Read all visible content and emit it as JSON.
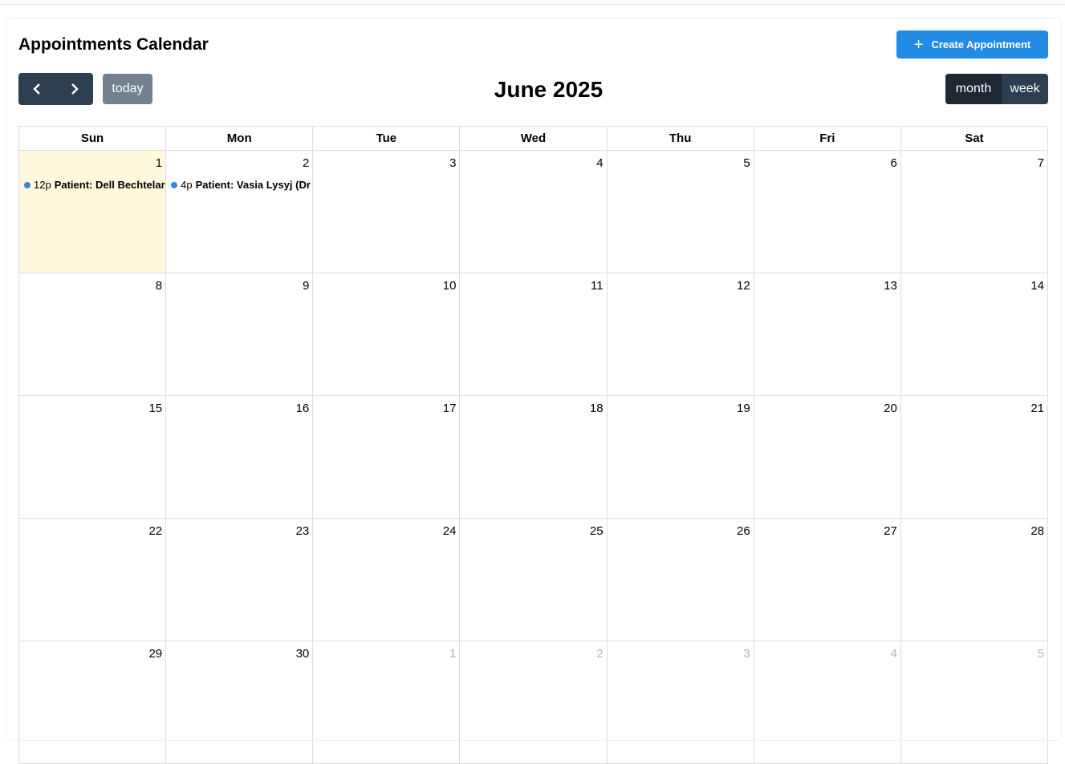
{
  "header": {
    "title": "Appointments Calendar",
    "create_label": "Create Appointment",
    "create_icon": "plus-icon"
  },
  "toolbar": {
    "prev_icon": "chevron-left-icon",
    "next_icon": "chevron-right-icon",
    "today_label": "today",
    "title": "June 2025",
    "views": [
      "month",
      "week"
    ],
    "active_view": "month"
  },
  "calendar": {
    "weekdays": [
      "Sun",
      "Mon",
      "Tue",
      "Wed",
      "Thu",
      "Fri",
      "Sat"
    ],
    "weeks": [
      [
        {
          "d": "1",
          "today": true
        },
        {
          "d": "2"
        },
        {
          "d": "3"
        },
        {
          "d": "4"
        },
        {
          "d": "5"
        },
        {
          "d": "6"
        },
        {
          "d": "7"
        }
      ],
      [
        {
          "d": "8"
        },
        {
          "d": "9"
        },
        {
          "d": "10"
        },
        {
          "d": "11"
        },
        {
          "d": "12"
        },
        {
          "d": "13"
        },
        {
          "d": "14"
        }
      ],
      [
        {
          "d": "15"
        },
        {
          "d": "16"
        },
        {
          "d": "17"
        },
        {
          "d": "18"
        },
        {
          "d": "19"
        },
        {
          "d": "20"
        },
        {
          "d": "21"
        }
      ],
      [
        {
          "d": "22"
        },
        {
          "d": "23"
        },
        {
          "d": "24"
        },
        {
          "d": "25"
        },
        {
          "d": "26"
        },
        {
          "d": "27"
        },
        {
          "d": "28"
        }
      ],
      [
        {
          "d": "29"
        },
        {
          "d": "30"
        },
        {
          "d": "1",
          "other": true
        },
        {
          "d": "2",
          "other": true
        },
        {
          "d": "3",
          "other": true
        },
        {
          "d": "4",
          "other": true
        },
        {
          "d": "5",
          "other": true
        }
      ]
    ],
    "events": [
      {
        "week": 0,
        "day": 0,
        "time": "12p",
        "title": "Patient: Dell Bechtelar"
      },
      {
        "week": 0,
        "day": 1,
        "time": "4p",
        "title": "Patient: Vasia Lysyj (Dr"
      }
    ],
    "event_color": "#3788d8",
    "today_color": "#fef8dd"
  }
}
